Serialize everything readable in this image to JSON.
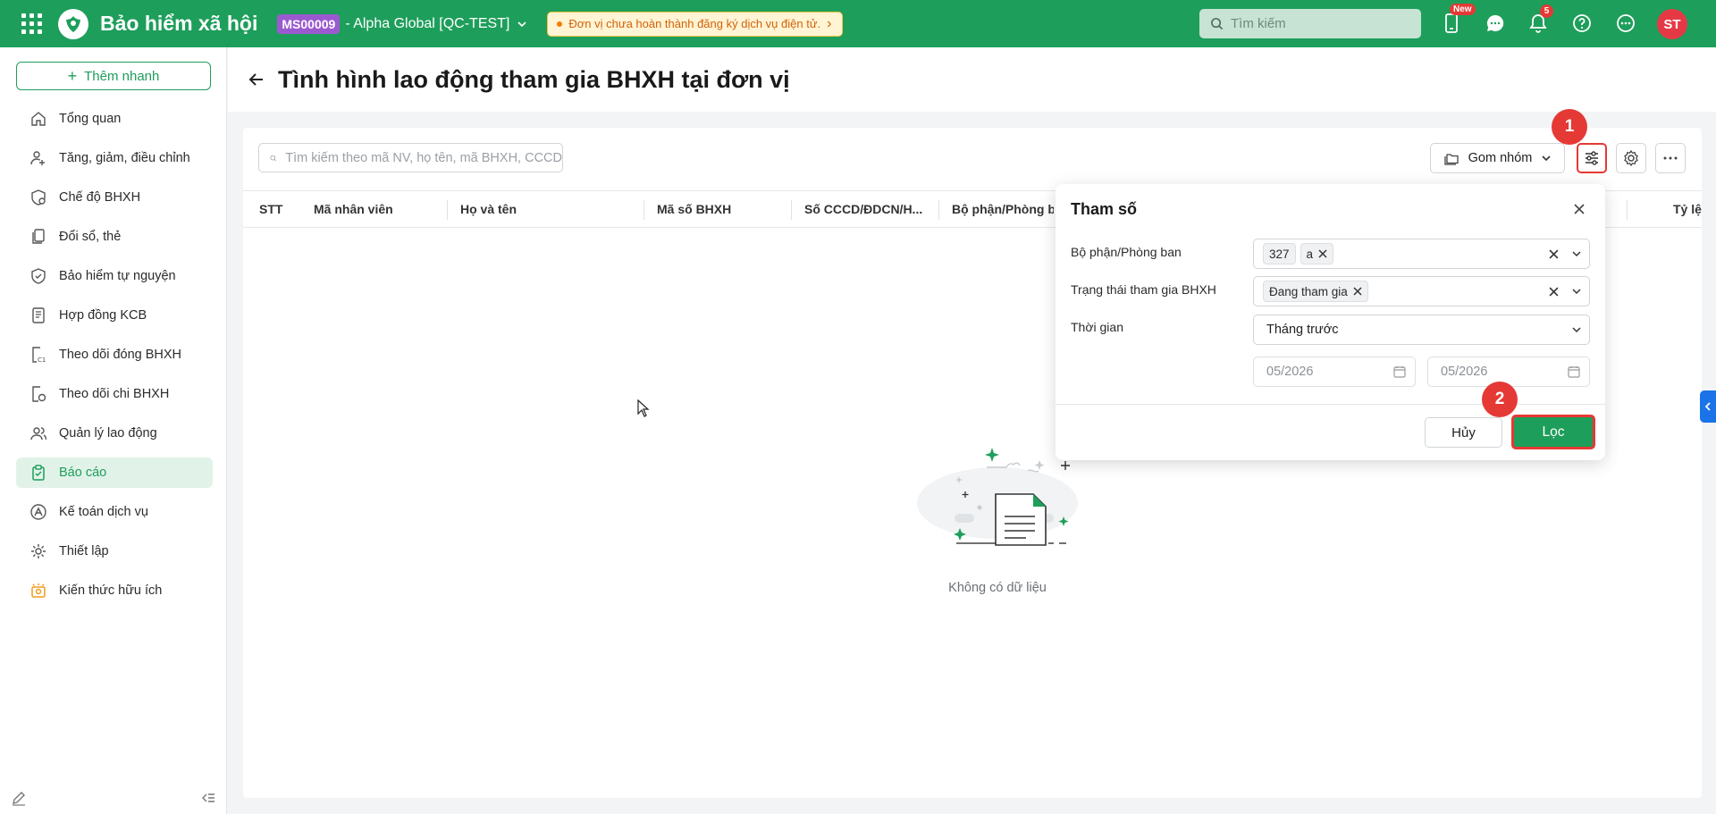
{
  "header": {
    "app_name": "Bảo hiểm xã hội",
    "unit_code": "MS00009",
    "org_name": "- Alpha Global [QC-TEST]",
    "warning": "Đơn vị chưa hoàn thành đăng ký dịch vụ điện tử.",
    "warning_arrow": "›",
    "search_placeholder": "Tìm kiếm",
    "new_badge": "New",
    "notification_count": "5",
    "avatar_initials": "ST",
    "brand_color": "#1e9e5b"
  },
  "sidebar": {
    "add_label": "Thêm nhanh",
    "items": [
      {
        "label": "Tổng quan",
        "icon": "home-icon"
      },
      {
        "label": "Tăng, giảm, điều chỉnh",
        "icon": "user-adjust-icon"
      },
      {
        "label": "Chế độ BHXH",
        "icon": "shield-heart-icon"
      },
      {
        "label": "Đổi sổ, thẻ",
        "icon": "cards-icon"
      },
      {
        "label": "Bảo hiểm tự nguyện",
        "icon": "shield-icon"
      },
      {
        "label": "Hợp đồng KCB",
        "icon": "contract-icon"
      },
      {
        "label": "Theo dõi đóng BHXH",
        "icon": "c12-icon"
      },
      {
        "label": "Theo dõi chi BHXH",
        "icon": "payout-icon"
      },
      {
        "label": "Quản lý lao động",
        "icon": "people-icon"
      },
      {
        "label": "Báo cáo",
        "icon": "clipboard-icon",
        "active": true
      },
      {
        "label": "Kế toán dịch vụ",
        "icon": "accounting-icon"
      },
      {
        "label": "Thiết lập",
        "icon": "gear-icon"
      },
      {
        "label": "Kiến thức hữu ích",
        "icon": "knowledge-icon"
      }
    ]
  },
  "page": {
    "title": "Tình hình lao động tham gia BHXH tại đơn vị",
    "search_placeholder": "Tìm kiếm theo mã NV, họ tên, mã BHXH, CCCD",
    "group_label": "Gom nhóm",
    "columns": [
      "STT",
      "Mã nhân viên",
      "Họ và tên",
      "Mã số BHXH",
      "Số CCCD/ĐDCN/H...",
      "Bộ phận/Phòng ban",
      "Tỷ lệ"
    ],
    "empty_text": "Không có dữ liệu",
    "step1": "1",
    "step2": "2"
  },
  "filter": {
    "title": "Tham số",
    "dept_label": "Bộ phận/Phòng ban",
    "dept_tags": [
      "327",
      "a"
    ],
    "status_label": "Trạng thái tham gia BHXH",
    "status_tag": "Đang tham gia",
    "time_label": "Thời gian",
    "time_value": "Tháng trước",
    "date_from": "05/2026",
    "date_to": "05/2026",
    "cancel_label": "Hủy",
    "apply_label": "Lọc"
  }
}
